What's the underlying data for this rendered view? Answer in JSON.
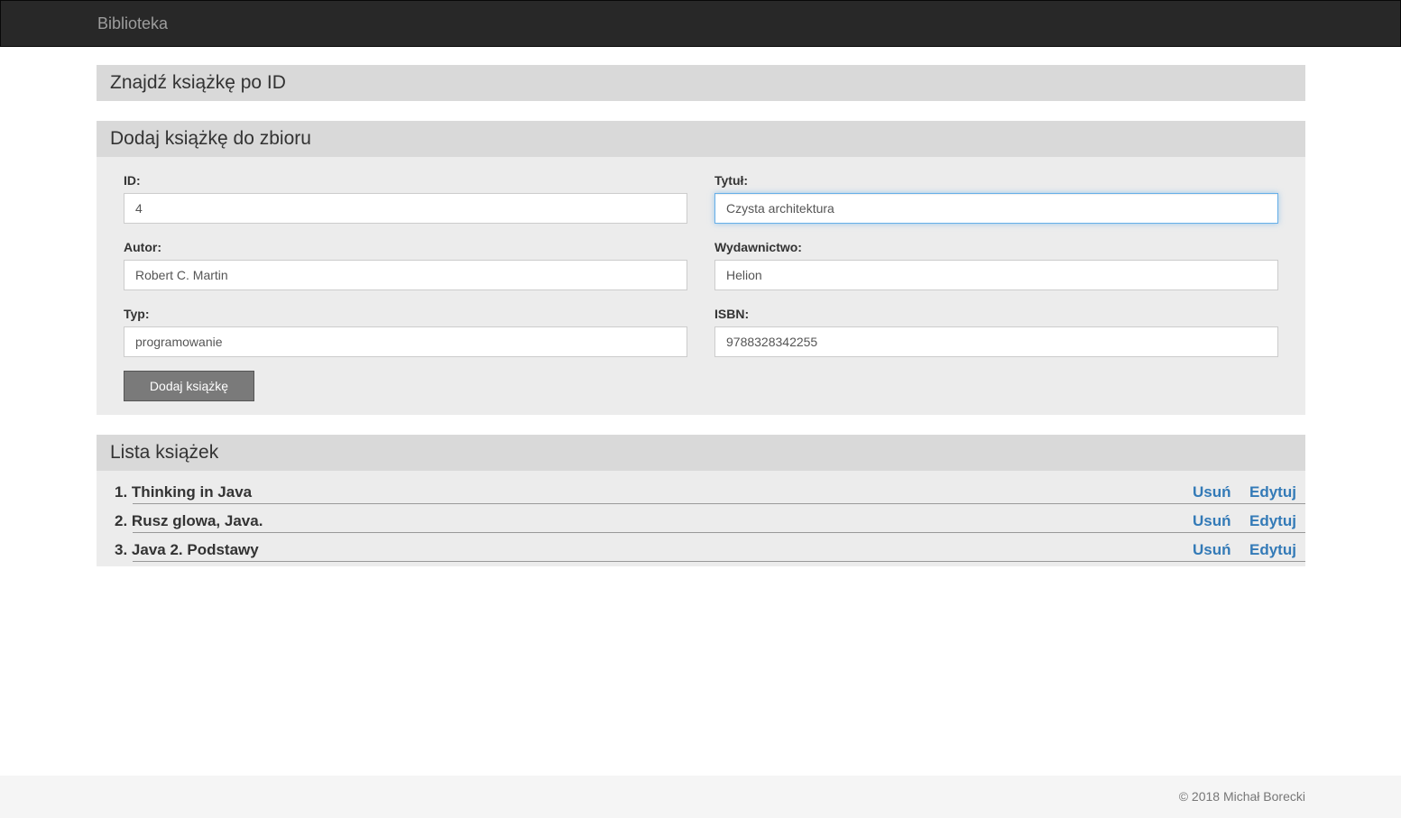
{
  "navbar": {
    "brand": "Biblioteka"
  },
  "find_panel": {
    "title": "Znajdź książkę po ID"
  },
  "add_panel": {
    "title": "Dodaj książkę do zbioru",
    "id_label": "ID:",
    "id_value": "4",
    "title_label": "Tytuł:",
    "title_value": "Czysta architektura",
    "author_label": "Autor:",
    "author_value": "Robert C. Martin",
    "publisher_label": "Wydawnictwo:",
    "publisher_value": "Helion",
    "type_label": "Typ:",
    "type_value": "programowanie",
    "isbn_label": "ISBN:",
    "isbn_value": "9788328342255",
    "submit_label": "Dodaj książkę"
  },
  "list_panel": {
    "title": "Lista książek",
    "delete_label": "Usuń",
    "edit_label": "Edytuj",
    "books": [
      {
        "index": "1.",
        "title": "Thinking in Java"
      },
      {
        "index": "2.",
        "title": "Rusz glowa, Java."
      },
      {
        "index": "3.",
        "title": "Java 2. Podstawy"
      }
    ]
  },
  "footer": {
    "copyright": "© 2018 Michał Borecki"
  },
  "colors": {
    "navbar": "#282828",
    "panel_header": "#d9d9d9",
    "panel_body": "#ececec",
    "link": "#337ab7",
    "button": "#7a7a7a"
  }
}
